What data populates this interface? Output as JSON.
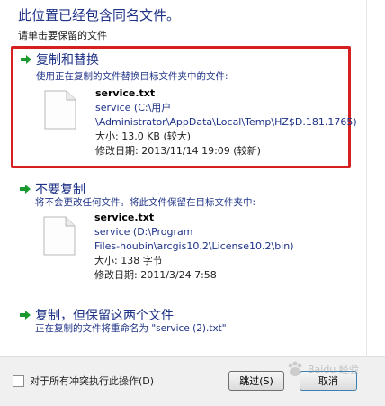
{
  "header": {
    "title": "此位置已经包含同名文件。",
    "subtitle": "请单击要保留的文件"
  },
  "options": [
    {
      "title": "复制和替换",
      "description": "使用正在复制的文件替换目标文件夹中的文件:",
      "file_name": "service.txt",
      "path_line1": "service (C:\\用户",
      "path_line2": "\\Administrator\\AppData\\Local\\Temp\\HZ$D.181.1765)",
      "size": "大小: 13.0 KB (较大)",
      "modified": "修改日期: 2013/11/14 19:09 (较新)"
    },
    {
      "title": "不要复制",
      "description": "将不会更改任何文件。将此文件保留在目标文件夹中:",
      "file_name": "service.txt",
      "path_line1": "service (D:\\Program",
      "path_line2": "Files-houbin\\arcgis10.2\\License10.2\\bin)",
      "size": "大小: 138 字节",
      "modified": "修改日期: 2011/3/24 7:58"
    },
    {
      "title": "复制，但保留这两个文件",
      "description": "正在复制的文件将重命名为 \"service (2).txt\""
    }
  ],
  "footer": {
    "checkbox_label": "对于所有冲突执行此操作(D)",
    "checkbox_checked": false,
    "skip_label": "跳过(S)",
    "cancel_label": "取消"
  },
  "watermark": {
    "text": "Baidu 经验"
  },
  "colors": {
    "accent": "#1e3287",
    "highlight_border": "#d42020",
    "arrow": "#1a9a2e"
  }
}
